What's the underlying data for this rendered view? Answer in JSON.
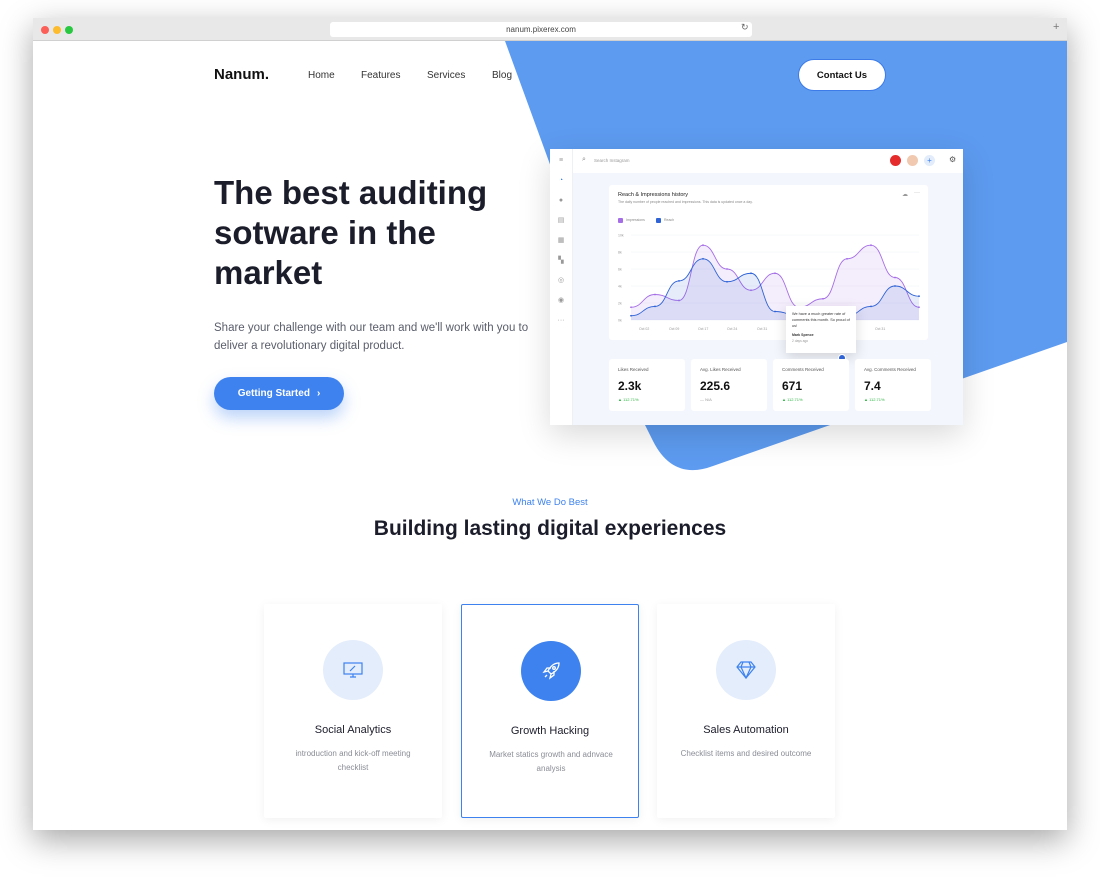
{
  "browser": {
    "url": "nanum.pixerex.com"
  },
  "nav": {
    "logo": "Nanum.",
    "items": [
      "Home",
      "Features",
      "Services",
      "Blog"
    ],
    "contact": "Contact Us"
  },
  "hero": {
    "title": "The best auditing sotware in the market",
    "subtitle": "Share your challenge with our team and we'll work with you to deliver a revolutionary digital product.",
    "cta": "Getting Started",
    "cta_icon": "chevron-right-icon"
  },
  "colors": {
    "accent": "#3d82ee",
    "blob": "#5d9bf0",
    "impressions": "#a56ee6",
    "reach": "#2f63d6",
    "positive": "#2fb344"
  },
  "dashboard": {
    "search_placeholder": "Search Instagram",
    "chart_title": "Reach & Impressions history",
    "chart_subtitle": "The daily number of people reached and impressions. This data is updated once a day.",
    "legend": [
      "Impressions",
      "Reach"
    ],
    "y_ticks": [
      "10k",
      "8k",
      "6k",
      "4k",
      "2k",
      "0k"
    ],
    "x_ticks": [
      "Oct 02",
      "Oct 09",
      "Oct 17",
      "Oct 24",
      "Oct 31",
      "Oct 24",
      "Oct 31"
    ],
    "series": {
      "impressions": [
        1.5,
        3,
        2.3,
        8.8,
        6,
        3.5,
        5.5,
        1.5,
        2.5,
        7.2,
        8.8,
        5,
        1.5
      ],
      "reach": [
        0.5,
        1.6,
        4.6,
        7.2,
        4.5,
        5.5,
        1,
        0.5,
        0.8,
        0.5,
        1.6,
        4,
        2.8
      ]
    },
    "tooltip": {
      "text": "We have a much greater rate of comments this month. So proud of us!",
      "author": "Mark Spence",
      "time": "2 days ago"
    },
    "kpis": [
      {
        "label": "Likes Received",
        "value": "2.3k",
        "delta": "▲ 112.71%"
      },
      {
        "label": "Avg. Likes Received",
        "value": "225.6",
        "delta": "— N/A"
      },
      {
        "label": "Comments Received",
        "value": "671",
        "delta": "▲ 112.71%"
      },
      {
        "label": "Avg. Comments Received",
        "value": "7.4",
        "delta": "▲ 112.71%"
      }
    ]
  },
  "services": {
    "eyebrow": "What We Do Best",
    "title": "Building lasting digital experiences",
    "cards": [
      {
        "title": "Social Analytics",
        "desc": "introduction and kick-off meeting checklist",
        "icon": "monitor-icon"
      },
      {
        "title": "Growth Hacking",
        "desc": "Market statics growth and adnvace analysis",
        "icon": "rocket-icon"
      },
      {
        "title": "Sales Automation",
        "desc": "Checklist items and desired outcome",
        "icon": "diamond-icon"
      }
    ]
  }
}
